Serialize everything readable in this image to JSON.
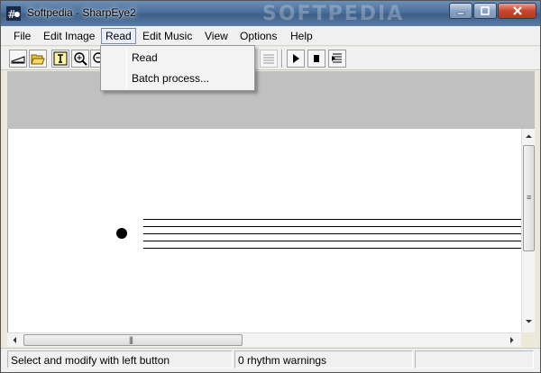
{
  "window": {
    "title": "Softpedia - SharpEye2",
    "title_watermark": "SOFTPEDIA",
    "controls": [
      "minimize",
      "maximize",
      "close"
    ]
  },
  "menubar": {
    "items": [
      {
        "label": "File"
      },
      {
        "label": "Edit Image"
      },
      {
        "label": "Read"
      },
      {
        "label": "Edit Music"
      },
      {
        "label": "View"
      },
      {
        "label": "Options"
      },
      {
        "label": "Help"
      }
    ],
    "open_menu": "Read"
  },
  "read_menu": {
    "items": [
      {
        "label": "Read"
      },
      {
        "label": "Batch process..."
      }
    ]
  },
  "toolbar": {
    "buttons": [
      "scanner-icon",
      "open-folder-icon",
      "text-icon",
      "zoom-in-icon",
      "zoom-out-icon",
      "score-icon",
      "play-icon",
      "stop-icon",
      "score-list-icon"
    ]
  },
  "score": {
    "staff_lines": 5
  },
  "statusbar": {
    "hint": "Select and modify with left button",
    "warnings": "0 rhythm warnings"
  },
  "colors": {
    "titlebar": "#4a6e99",
    "gray_area": "#c0c0c0",
    "menu_bg": "#f0f0f0"
  }
}
